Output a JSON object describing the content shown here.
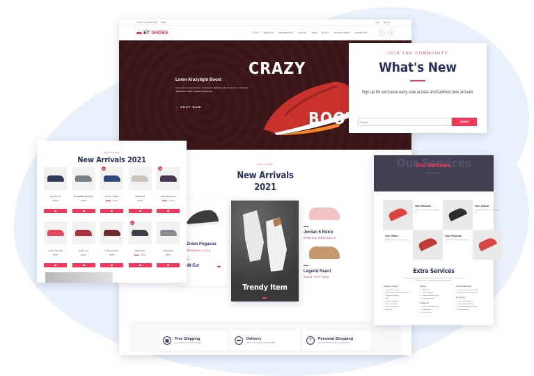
{
  "colors": {
    "accent": "#f2385a",
    "navy": "#2b2f5b",
    "hero_bg": "#3a1517",
    "services_header": "#413f51",
    "background_blob": "#eaf1fc"
  },
  "main": {
    "topbar": {
      "phone": "Call Us: +01 234 567 890",
      "email": "Email",
      "links": [
        "Help",
        "Sign Up"
      ]
    },
    "logo": {
      "part1": "ET",
      "part2": "SHOES",
      "icon": "shoe-icon"
    },
    "nav": [
      "HOME",
      "ABOUT US",
      "OUR SERVICES",
      "GALLERY",
      "FAQS",
      "BLOG ▾",
      "ONLINE STORE ▾",
      "CONTACT US"
    ],
    "social": [
      "f",
      "t"
    ],
    "hero": {
      "title1": "CRAZY",
      "title2": "BOOTS",
      "subtitle": "Loren Krazylight Boost",
      "description": "Lorem ipsum dolor sit amet, consectetur adipiscing elit. Ut elit tellus, luctus nec ullamcorper mattis, pulvinar dapibus leo.",
      "button": "→  SHOP NOW"
    },
    "new_arrivals": {
      "welcome": "WELCOME",
      "title_line1": "New Arrivals",
      "title_line2": "2021"
    },
    "left_product": {
      "name": "Zoom Pegasus",
      "sub": "SEASON 2020",
      "price": "48 Eur",
      "price_label": "Price"
    },
    "trendy": {
      "label": "Trendy Item"
    },
    "right_products": [
      {
        "name": "Jordan 5 Retro",
        "sub": "SPRING ARRIVALS"
      },
      {
        "name": "Legend React",
        "sub": "SALE OFF 50%"
      }
    ],
    "features": [
      {
        "icon": "shopping-bag-icon",
        "glyph": "▣",
        "title": "Free Shipping",
        "desc": "Free shipping returns within 14 days."
      },
      {
        "icon": "truck-icon",
        "glyph": "▬",
        "title": "Delivery",
        "desc": "Find out the shopping options available."
      },
      {
        "icon": "question-icon",
        "glyph": "?",
        "title": "Personal Shopping",
        "desc": "Need help with your order or styling advice?"
      }
    ]
  },
  "community": {
    "kicker": "JOIN THE COMMUNITY",
    "title": "What's New",
    "text": "Sign up for exclusive early sale access and tailored new arrivals.",
    "email_placeholder": "Email",
    "submit": "SUBMIT"
  },
  "arrivals": {
    "welcome": "WELCOME",
    "title": "New Arrivals 2021",
    "products": [
      {
        "name": "Air Force 1 '07",
        "price": "£99.00",
        "sale": false,
        "color": "#2f3a5c"
      },
      {
        "name": "Air VaporMax 2020 Flyknit",
        "price": "£99.00",
        "sale": false,
        "color": "#7a7f86"
      },
      {
        "name": "Air Force 1 Result",
        "old": "£99.00",
        "price": "£39.00",
        "sale": true,
        "color": "#2d4a7a"
      },
      {
        "name": "Offcode Type",
        "price": "£55.00",
        "sale": false,
        "color": "#c9c3bb"
      },
      {
        "name": "Giant Royals 2 Low",
        "old": "£99.00",
        "price": "£79.00",
        "sale": true,
        "color": "#463652"
      },
      {
        "name": "Jordan 7 Retro SE",
        "price": "£99.00",
        "sale": false,
        "color": "#e04a5e"
      },
      {
        "name": "Jordan 7 Low",
        "price": "£99.00",
        "sale": false,
        "color": "#a8333d"
      },
      {
        "name": "Jordan Tech Pack",
        "price": "£99.00",
        "sale": false,
        "color": "#6f2a2c"
      },
      {
        "name": "Jordan 5 Retro",
        "old": "£79.00",
        "price": "£66.00",
        "sale": true,
        "color": "#3b4048"
      },
      {
        "name": "Jordan Evolve",
        "price": "£99.00",
        "sale": false,
        "color": "#8a8d92"
      }
    ]
  },
  "services": {
    "ghost": "Our Services",
    "title": "Our Services.",
    "subtitle": "Home / Our Services",
    "items": [
      {
        "type": "img",
        "color": "#d8453f"
      },
      {
        "type": "txt",
        "title": "Our Mission",
        "desc": "Lorem ipsum dolor sit amet, adipiscing elit."
      },
      {
        "type": "img",
        "color": "#2d2d2d"
      },
      {
        "type": "txt",
        "title": "Our Vision",
        "desc": "Lorem ipsum dolor sit amet, adipiscing elit."
      },
      {
        "type": "txt",
        "title": "Our Value",
        "desc": "Lorem ipsum dolor sit amet, adipiscing elit."
      },
      {
        "type": "img",
        "color": "#c23a36"
      },
      {
        "type": "txt",
        "title": "Our Purpose",
        "desc": "Lorem ipsum dolor sit amet, adipiscing elit."
      },
      {
        "type": "img",
        "color": "#d8453f"
      }
    ],
    "extra_title": "Extra Services",
    "extra_desc": "Lorem ipsum dolor sit amet, consectetur adipiscing elit. Sed do eiusmod tempor incididunt ut labore et dolore magna aliqua. Ut enim ad minim veniam, quis nostrud exercitation.",
    "columns": [
      {
        "groups": [
          {
            "title": "Customer Support",
            "items": [
              "Refund Per Exchanges",
              "Exclusive Fashion Ordering Competition",
              "Shipping and Delivery",
              "FAQ",
              "Returns & Exchanges",
              "Terms & Conditions",
              "Gift Card / Gift Brand",
              "Gift Guide"
            ]
          }
        ]
      },
      {
        "groups": [
          {
            "title": "Policies",
            "items": [
              "Privacy Policy",
              "Terms / Conditions",
              "Customer Satisfaction Policy",
              "Low Price Guarantee"
            ]
          },
          {
            "title": "Contact Us",
            "items": [
              "Contact / Mail, Phone, Email",
              "Customer Care",
              "Order by Phone"
            ]
          }
        ]
      },
      {
        "groups": [
          {
            "title": "Product Warranties",
            "items": [
              "Warranty Service Protection Plans",
              "Register Service Protection Plan"
            ]
          },
          {
            "title": "My Account",
            "items": [
              "Change Billing Address",
              "Change Shipping Address",
              "View Exclusive Advantage Rules",
              "View Saved Items"
            ]
          }
        ]
      }
    ]
  }
}
